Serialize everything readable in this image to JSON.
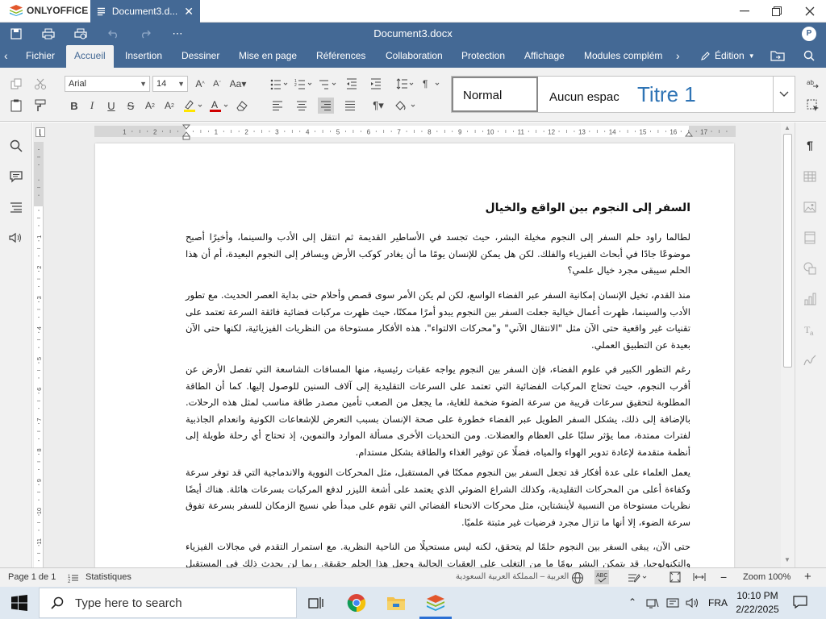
{
  "app": {
    "brand": "ONLYOFFICE",
    "tab_title": "Document3.d...",
    "document_title": "Document3.docx",
    "user_initial": "P"
  },
  "menu": {
    "tabs": [
      "Fichier",
      "Accueil",
      "Insertion",
      "Dessiner",
      "Mise en page",
      "Références",
      "Collaboration",
      "Protection",
      "Affichage",
      "Modules complém"
    ],
    "active": "Accueil",
    "edit_mode": "Édition"
  },
  "toolbar": {
    "font_name": "Arial",
    "font_size": "14",
    "styles": [
      "Normal",
      "Aucun espac",
      "Titre 1"
    ]
  },
  "ruler": {
    "h_labels": [
      "1",
      "2",
      "1",
      "2",
      "3",
      "4",
      "5",
      "6",
      "7",
      "8",
      "9",
      "10",
      "11",
      "12",
      "13",
      "14",
      "15",
      "16",
      "17"
    ],
    "v_labels": [
      "1",
      "2",
      "3",
      "4",
      "5",
      "6",
      "7",
      "8",
      "9",
      "10",
      "11",
      "12"
    ]
  },
  "document": {
    "title": "السفر إلى النجوم بين الواقع والخيال",
    "paragraphs": [
      "لطالما راود حلم السفر إلى النجوم مخيلة البشر، حيث تجسد في الأساطير القديمة ثم انتقل إلى الأدب والسينما، وأخيرًا أصبح موضوعًا جادًا في أبحاث الفيزياء والفلك. لكن هل يمكن للإنسان يومًا ما أن يغادر كوكب الأرض ويسافر إلى النجوم البعيدة، أم أن هذا الحلم سيبقى مجرد خيال علمي؟",
      "منذ القدم، تخيل الإنسان إمكانية السفر عبر الفضاء الواسع، لكن لم يكن الأمر سوى قصص وأحلام حتى بداية العصر الحديث. مع تطور الأدب والسينما، ظهرت أعمال خيالية جعلت السفر بين النجوم يبدو أمرًا ممكنًا، حيث ظهرت مركبات فضائية فائقة السرعة تعتمد على تقنيات غير واقعية حتى الآن مثل \"الانتقال الآني\" و\"محركات الالتواء\". هذه الأفكار مستوحاة من النظريات الفيزيائية، لكنها حتى الآن بعيدة عن التطبيق العملي.",
      "رغم التطور الكبير في علوم الفضاء، فإن السفر بين النجوم يواجه عقبات رئيسية، منها المسافات الشاسعة التي تفصل الأرض عن أقرب النجوم، حيث تحتاج المركبات الفضائية التي تعتمد على السرعات التقليدية إلى آلاف السنين للوصول إليها. كما أن الطاقة المطلوبة لتحقيق سرعات قريبة من سرعة الضوء ضخمة للغاية، ما يجعل من الصعب تأمين مصدر طاقة مناسب لمثل هذه الرحلات. بالإضافة إلى ذلك، يشكل السفر الطويل عبر الفضاء خطورة على صحة الإنسان بسبب التعرض للإشعاعات الكونية وانعدام الجاذبية لفترات ممتدة، مما يؤثر سلبًا على العظام والعضلات. ومن التحديات الأخرى مسألة الموارد والتموين، إذ تحتاج أي رحلة طويلة إلى أنظمة متقدمة لإعادة تدوير الهواء والمياه، فضلًا عن توفير الغذاء والطاقة بشكل مستدام.",
      "يعمل العلماء على عدة أفكار قد تجعل السفر بين النجوم ممكنًا في المستقبل، مثل المحركات النووية والاندماجية التي قد توفر سرعة وكفاءة أعلى من المحركات التقليدية، وكذلك الشراع الضوئي الذي يعتمد على أشعة الليزر لدفع المركبات بسرعات هائلة. هناك أيضًا نظريات مستوحاة من النسبية لأينشتاين، مثل محركات الانحناء الفضائي التي تقوم على مبدأ طي نسيج الزمكان للسفر بسرعة تفوق سرعة الضوء، إلا أنها ما تزال مجرد فرضيات غير مثبتة علميًا.",
      "حتى الآن، يبقى السفر بين النجوم حلمًا لم يتحقق، لكنه ليس مستحيلًا من الناحية النظرية. مع استمرار التقدم في مجالات الفيزياء والتكنولوجيا، قد يتمكن البشر يومًا ما من التغلب على العقبات الحالية وجعل هذا الحلم حقيقة. ربما لن يحدث ذلك في المستقبل القريب،"
    ]
  },
  "statusbar": {
    "page": "Page 1 de 1",
    "stats": "Statistiques",
    "language": "العربية – المملكة العربية السعودية",
    "zoom": "Zoom 100%"
  },
  "taskbar": {
    "search_placeholder": "Type here to search",
    "lang": "FRA",
    "time": "10:10 PM",
    "date": "2/22/2025"
  },
  "colors": {
    "accent": "#446995",
    "toolbar_bg": "#f1f1f1",
    "title_blue": "#2f74b5"
  }
}
